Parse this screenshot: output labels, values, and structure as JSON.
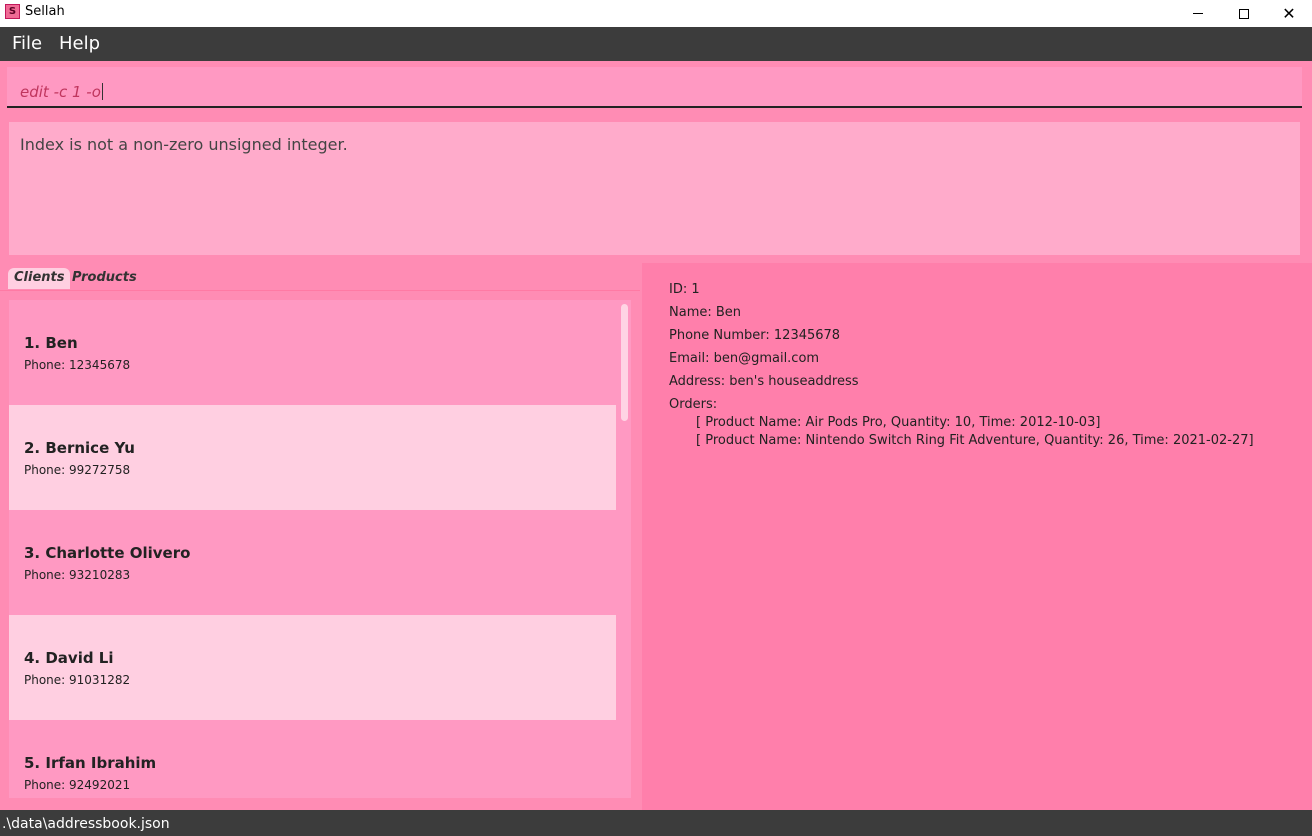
{
  "window": {
    "app_icon_letter": "S",
    "title": "Sellah",
    "close_glyph": "✕"
  },
  "menu": {
    "file_label": "File",
    "help_label": "Help"
  },
  "command": {
    "value": "edit -c 1 -o"
  },
  "result": {
    "message": "Index is not a non-zero unsigned integer."
  },
  "tabs": {
    "clients_label": "Clients",
    "products_label": "Products"
  },
  "clients": [
    {
      "name": "1.  Ben",
      "phone": "Phone: 12345678"
    },
    {
      "name": "2.  Bernice Yu",
      "phone": "Phone: 99272758"
    },
    {
      "name": "3.  Charlotte Olivero",
      "phone": "Phone: 93210283"
    },
    {
      "name": "4.  David Li",
      "phone": "Phone: 91031282"
    },
    {
      "name": "5.  Irfan Ibrahim",
      "phone": "Phone: 92492021"
    }
  ],
  "detail": {
    "id": "ID: 1",
    "name": "Name: Ben",
    "phone": "Phone Number: 12345678",
    "email": "Email: ben@gmail.com",
    "address": "Address: ben's houseaddress",
    "orders_label": "Orders:",
    "orders": [
      "[ Product Name: Air Pods Pro, Quantity: 10, Time: 2012-10-03]",
      "[ Product Name: Nintendo Switch Ring Fit Adventure, Quantity: 26, Time: 2021-02-27]"
    ]
  },
  "status": {
    "path": ".\\data\\addressbook.json"
  },
  "colors": {
    "accent": "#ff7fab",
    "panel": "#ff99c2",
    "card_alt": "#ffcfe1",
    "bar": "#3c3c3c"
  }
}
